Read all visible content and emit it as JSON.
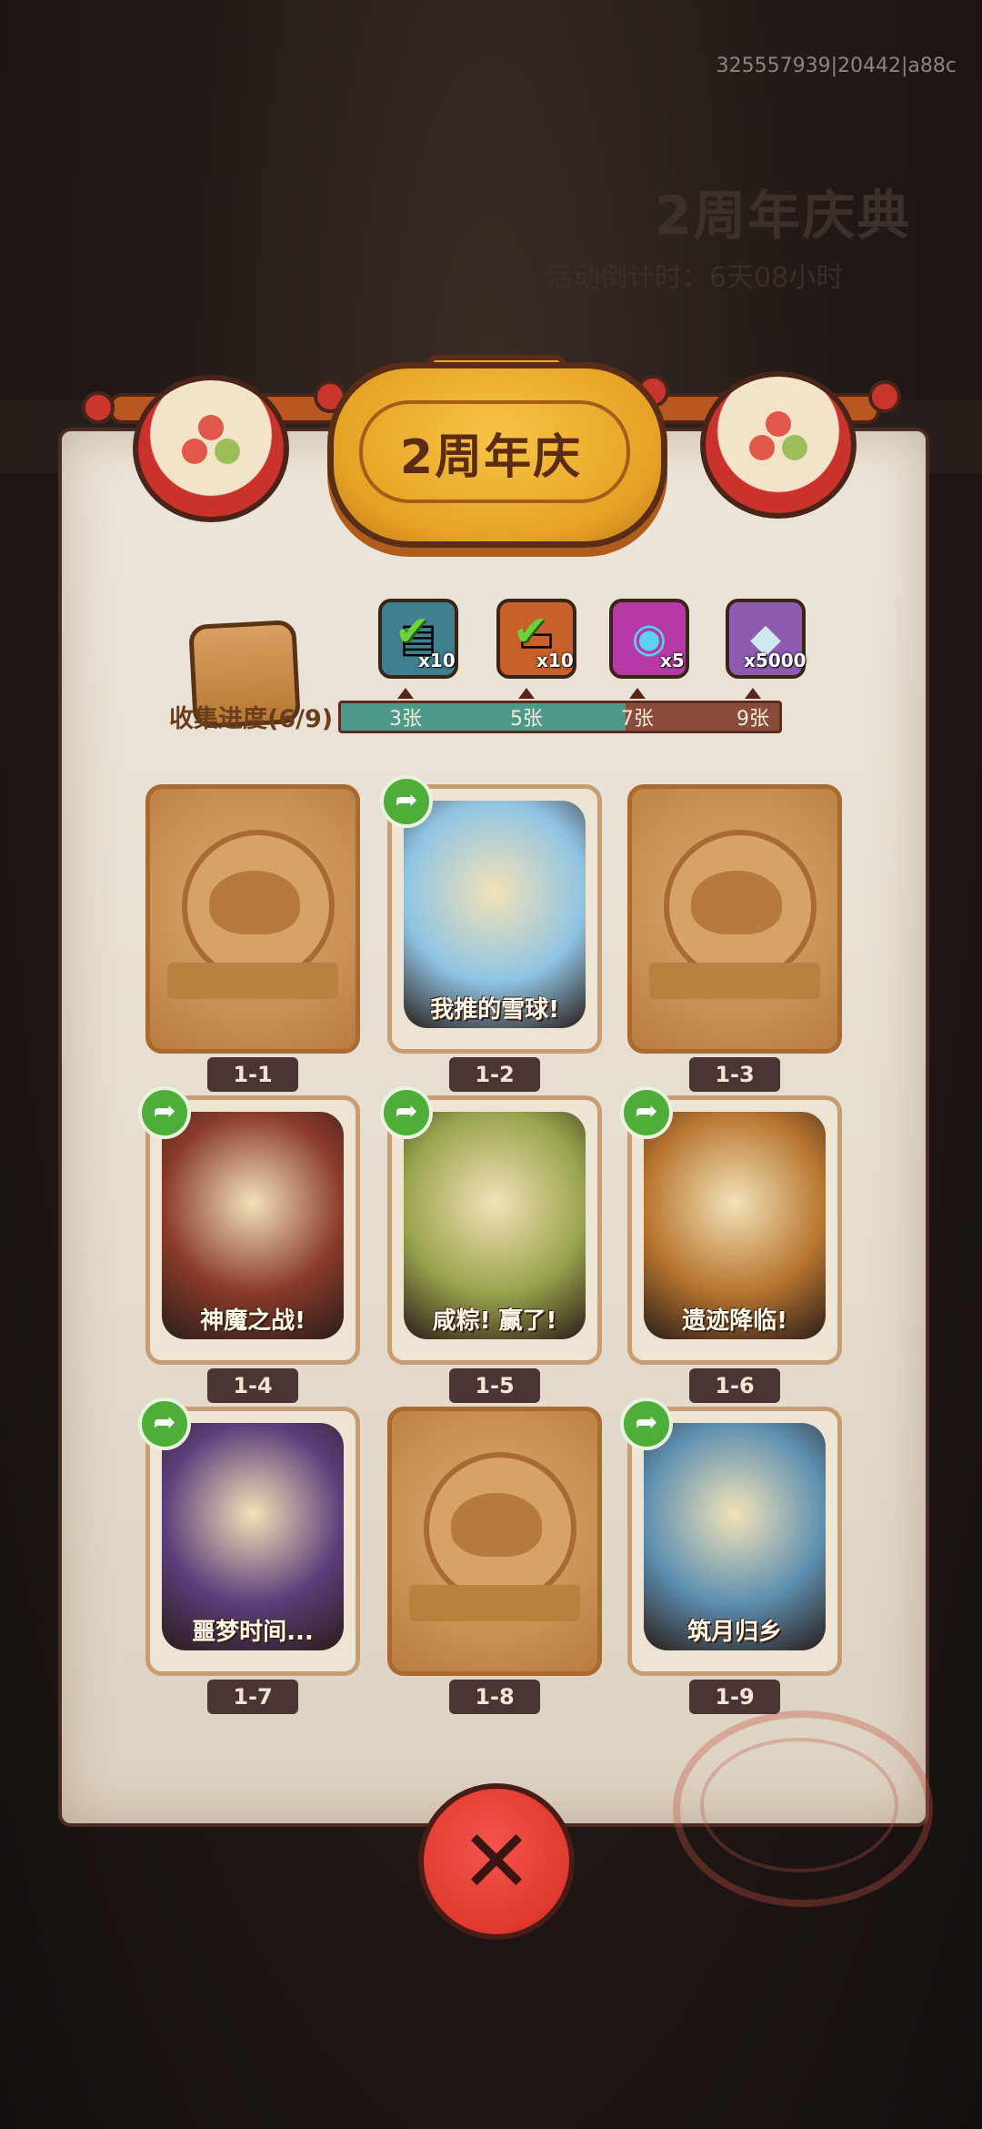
{
  "debug_id": "325557939|20442|a88c",
  "background": {
    "title": "2周年庆典",
    "subtitle": "活动倒计时：6天08小时"
  },
  "header": {
    "title": "2周年庆"
  },
  "collection": {
    "label": "收集进度(6/9)",
    "progress_fraction": 0.65,
    "milestones": [
      "3张",
      "5张",
      "7张",
      "9张"
    ],
    "rewards": [
      {
        "name": "treasure-chest-reward",
        "count": "x10",
        "claimed": true,
        "color": "#3f7f8f"
      },
      {
        "name": "ticket-reward",
        "count": "x10",
        "claimed": true,
        "color": "#c7602b"
      },
      {
        "name": "orb-reward",
        "count": "x5",
        "claimed": false,
        "color": "#b63aa5"
      },
      {
        "name": "crystal-reward",
        "count": "x5000",
        "claimed": false,
        "color": "#8f5bb1"
      }
    ]
  },
  "cards": [
    {
      "id": "1-1",
      "title": "",
      "unlocked": false
    },
    {
      "id": "1-2",
      "title": "我推的雪球!",
      "unlocked": true,
      "color": "#8fc4e3"
    },
    {
      "id": "1-3",
      "title": "",
      "unlocked": false
    },
    {
      "id": "1-4",
      "title": "神魔之战!",
      "unlocked": true,
      "color": "#8a3a2a"
    },
    {
      "id": "1-5",
      "title": "咸粽! 赢了!",
      "unlocked": true,
      "color": "#9aa44c"
    },
    {
      "id": "1-6",
      "title": "遗迹降临!",
      "unlocked": true,
      "color": "#b8752f"
    },
    {
      "id": "1-7",
      "title": "噩梦时间...",
      "unlocked": true,
      "color": "#5b3d7a"
    },
    {
      "id": "1-8",
      "title": "",
      "unlocked": false
    },
    {
      "id": "1-9",
      "title": "筑月归乡",
      "unlocked": true,
      "color": "#5d8fb0"
    }
  ],
  "close_label": "✕"
}
